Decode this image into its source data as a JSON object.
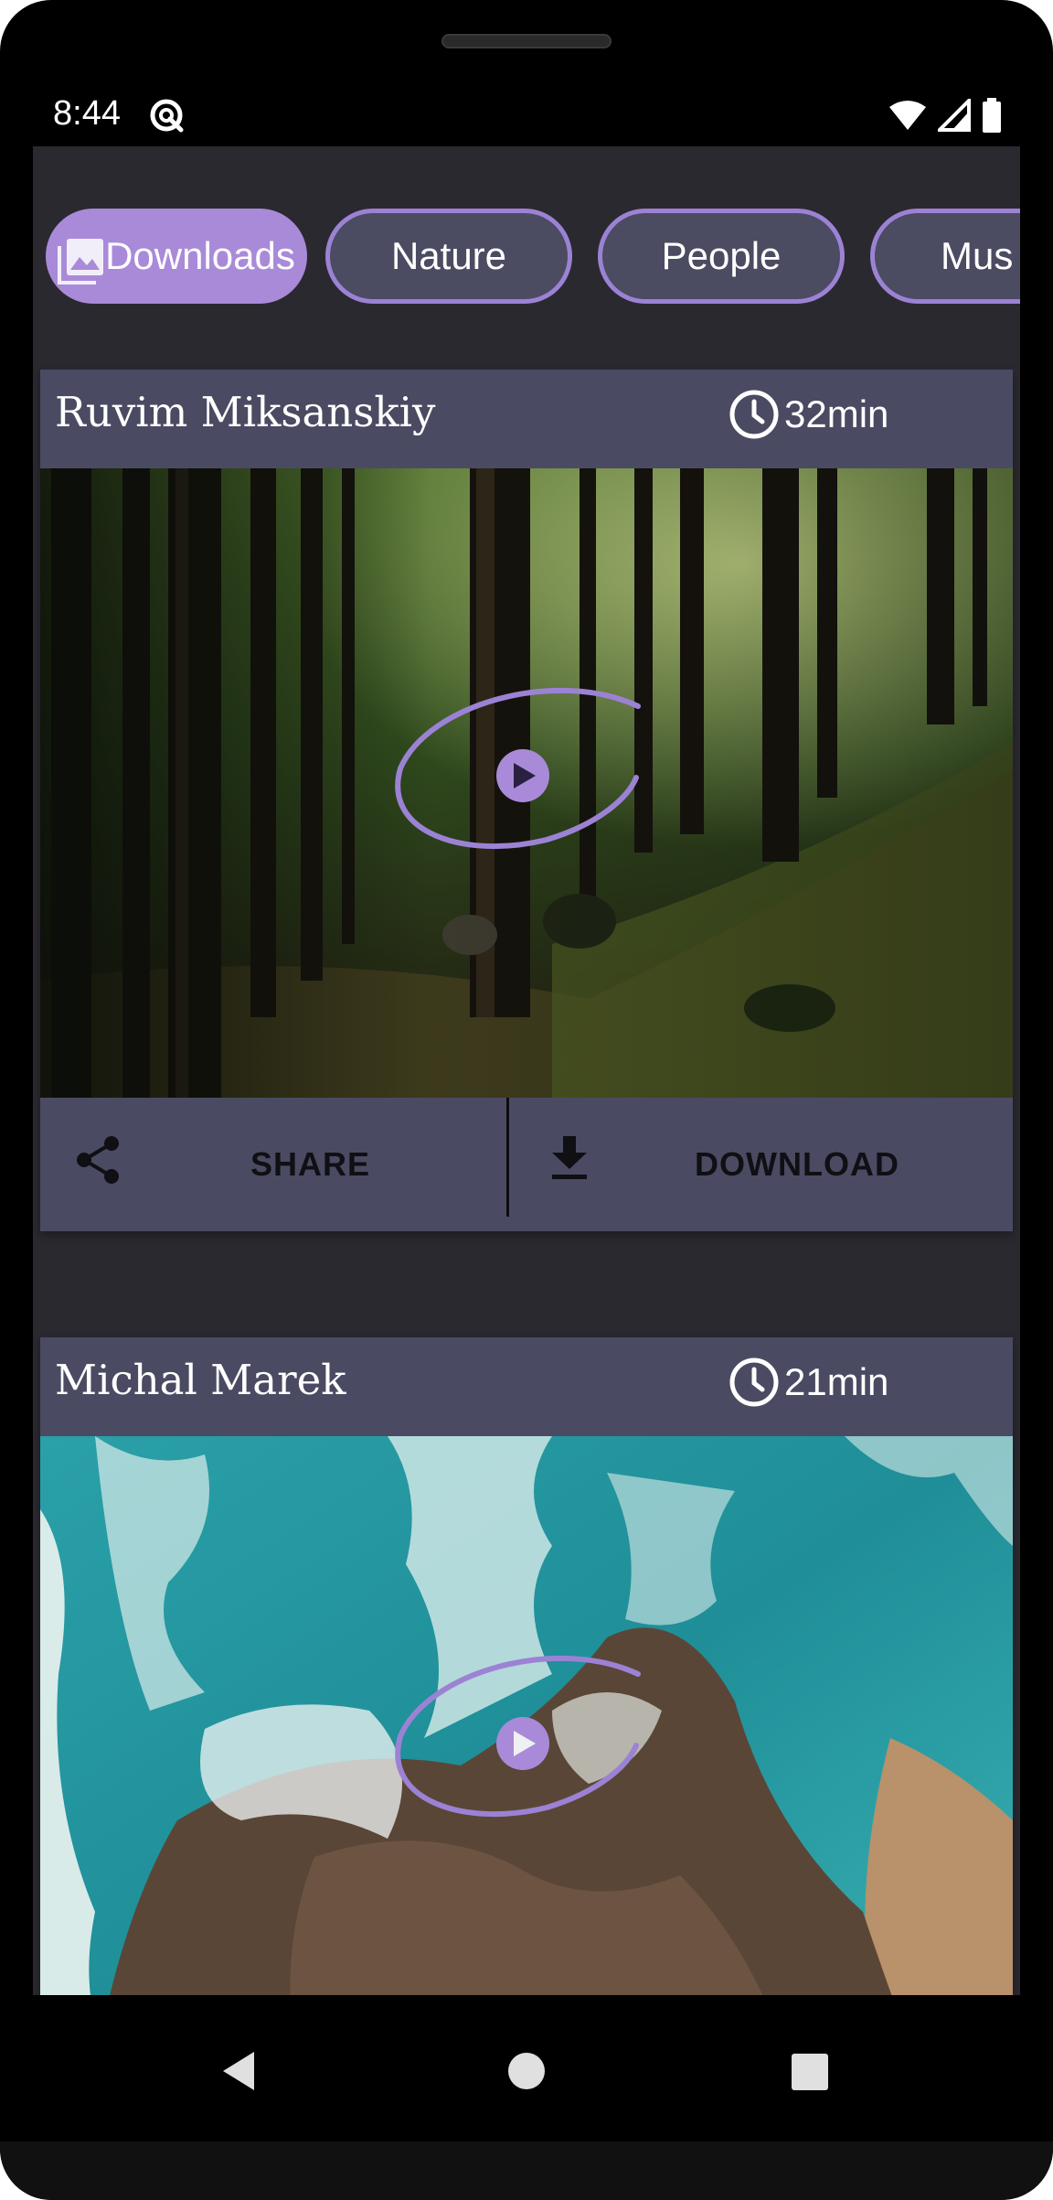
{
  "status_bar": {
    "time": "8:44",
    "icons": [
      "app-notification-icon",
      "wifi-icon",
      "signal-icon",
      "battery-icon"
    ]
  },
  "categories": [
    {
      "label": "Downloads",
      "selected": true,
      "icon": "photo-library-icon"
    },
    {
      "label": "Nature",
      "selected": false
    },
    {
      "label": "People",
      "selected": false
    },
    {
      "label": "Mus",
      "selected": false
    }
  ],
  "cards": [
    {
      "author": "Ruvim Miksanskiy",
      "duration": "32min",
      "thumbnail": "forest-scene",
      "actions": {
        "share": "SHARE",
        "download": "DOWNLOAD"
      }
    },
    {
      "author": "Michal Marek",
      "duration": "21min",
      "thumbnail": "ocean-coast-scene"
    }
  ],
  "colors": {
    "accent": "#a98ad8",
    "chip_border": "#9c82d4",
    "card_bg": "#4a4b62",
    "app_bg": "#2b2930",
    "chip_bg": "#4b4b62"
  },
  "nav_bar": {
    "buttons": [
      "back-icon",
      "home-icon",
      "recents-icon"
    ]
  }
}
